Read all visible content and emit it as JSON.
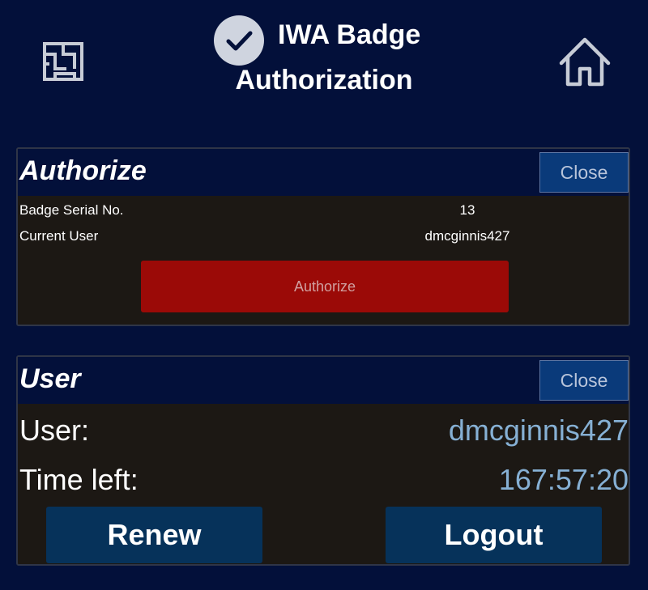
{
  "header": {
    "title_line1": "IWA Badge",
    "title_line2": "Authorization",
    "icons": [
      "maze-icon",
      "check-circle-icon",
      "home-icon"
    ]
  },
  "authorize_panel": {
    "title": "Authorize",
    "close_label": "Close",
    "rows": [
      {
        "label": "Badge Serial No.",
        "value": "13"
      },
      {
        "label": "Current User",
        "value": "dmcginnis427"
      }
    ],
    "authorize_label": "Authorize"
  },
  "user_panel": {
    "title": "User",
    "close_label": "Close",
    "user_label": "User:",
    "user_value": "dmcginnis427",
    "time_label": "Time left:",
    "time_value": "167:57:20",
    "renew_label": "Renew",
    "logout_label": "Logout"
  },
  "colors": {
    "background": "#03103a",
    "panel_body": "#1c1814",
    "close_button": "#0a3a7a",
    "authorize_button": "#9b0a07",
    "action_button": "#06325a",
    "value_text": "#86b0d4"
  }
}
